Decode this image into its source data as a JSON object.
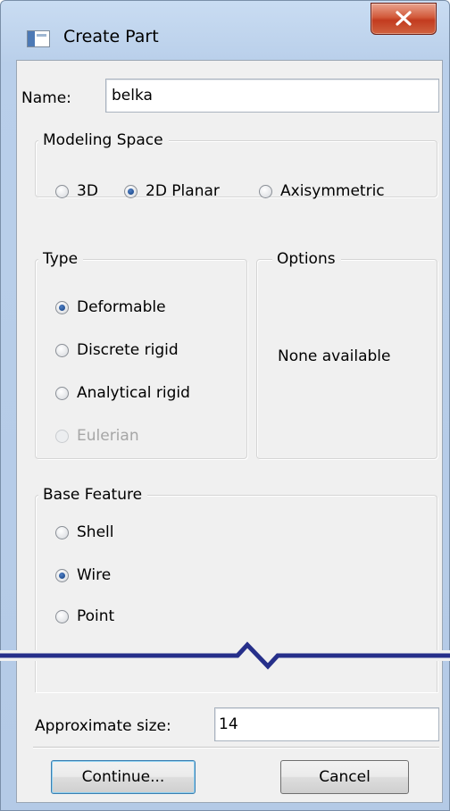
{
  "window": {
    "title": "Create Part",
    "close_glyph": "✕"
  },
  "name_field": {
    "label": "Name:",
    "value": "belka"
  },
  "modeling_space": {
    "title": "Modeling Space",
    "options": [
      {
        "label": "3D",
        "checked": false
      },
      {
        "label": "2D Planar",
        "checked": true
      },
      {
        "label": "Axisymmetric",
        "checked": false
      }
    ]
  },
  "type": {
    "title": "Type",
    "options": [
      {
        "label": "Deformable",
        "checked": true,
        "disabled": false
      },
      {
        "label": "Discrete rigid",
        "checked": false,
        "disabled": false
      },
      {
        "label": "Analytical rigid",
        "checked": false,
        "disabled": false
      },
      {
        "label": "Eulerian",
        "checked": false,
        "disabled": true
      }
    ]
  },
  "options_group": {
    "title": "Options",
    "message": "None available"
  },
  "base_feature": {
    "title": "Base Feature",
    "options": [
      {
        "label": "Shell",
        "checked": false
      },
      {
        "label": "Wire",
        "checked": true
      },
      {
        "label": "Point",
        "checked": false
      }
    ]
  },
  "approx_size": {
    "label": "Approximate size:",
    "value": "14"
  },
  "buttons": {
    "continue": "Continue...",
    "cancel": "Cancel"
  },
  "colors": {
    "title_bar": "#b9cfea",
    "close_button": "#c94a2e",
    "panel": "#f0f0f0",
    "break_line": "#262f8a",
    "radio_checked": "#1e4b8d"
  },
  "icons": {
    "app": "window-app-icon",
    "close": "close-icon",
    "break": "cut-break-line-icon"
  }
}
